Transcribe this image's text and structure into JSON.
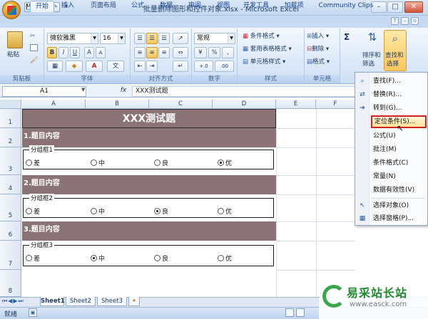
{
  "window": {
    "title": "批量删除图形和控件对象.xlsx - Microsoft Excel",
    "min": "–",
    "max": "□",
    "close": "✕"
  },
  "qat": [
    "💾",
    "↶",
    "↷",
    "▾"
  ],
  "tabs": [
    "开始",
    "插入",
    "页面布局",
    "公式",
    "数据",
    "审阅",
    "视图",
    "开发工具",
    "加载项",
    "Community Clips"
  ],
  "ribbon": {
    "clipboard": {
      "label": "剪贴板",
      "paste": "粘贴"
    },
    "font": {
      "label": "字体",
      "name": "微软雅黑",
      "size": "16",
      "bold": "B",
      "italic": "I",
      "underline": "U",
      "grow": "A",
      "shrink": "A",
      "fontcolor": "A",
      "wen": "文"
    },
    "align": {
      "label": "对齐方式"
    },
    "number": {
      "label": "数字",
      "format": "常规",
      "percent": "%",
      "comma": ",",
      "dec_inc": "+.0",
      "dec_dec": ".00"
    },
    "styles": {
      "label": "样式",
      "cond": "条件格式",
      "table": "套用表格格式",
      "cell": "单元格样式"
    },
    "cells": {
      "label": "单元格",
      "insert": "插入",
      "delete": "删除",
      "format": "格式"
    },
    "editing": {
      "sum": "Σ",
      "sort": "排序和",
      "sort2": "筛选",
      "find": "查找和",
      "find2": "选择"
    }
  },
  "formula_bar": {
    "namebox": "A1",
    "fx": "fx",
    "content": "XXX测试题"
  },
  "columns": [
    "A",
    "B",
    "C",
    "D",
    "E",
    "F"
  ],
  "rows": [
    "1",
    "2",
    "3",
    "4",
    "5",
    "6",
    "7",
    "8"
  ],
  "sheet": {
    "title": "XXX测试题",
    "sections": [
      {
        "heading": "1.题目内容",
        "group": "分组框1",
        "options": [
          "差",
          "中",
          "良",
          "优"
        ],
        "selected": 3
      },
      {
        "heading": "2.题目内容",
        "group": "分组框2",
        "options": [
          "差",
          "中",
          "良",
          "优"
        ],
        "selected": 2
      },
      {
        "heading": "3.题目内容",
        "group": "分组框3",
        "options": [
          "差",
          "中",
          "良",
          "优"
        ],
        "selected": 1
      }
    ]
  },
  "menu": {
    "items": [
      {
        "label": "查找(F)...",
        "icon": "⌕"
      },
      {
        "label": "替换(R)...",
        "icon": "⇄"
      },
      {
        "label": "转到(G)...",
        "icon": "➔"
      },
      {
        "label": "定位条件(S)...",
        "icon": ""
      },
      {
        "label": "公式(U)",
        "icon": ""
      },
      {
        "label": "批注(M)",
        "icon": ""
      },
      {
        "label": "条件格式(C)",
        "icon": ""
      },
      {
        "label": "常量(N)",
        "icon": ""
      },
      {
        "label": "数据有效性(V)",
        "icon": ""
      },
      {
        "label": "选择对象(O)",
        "icon": "↖"
      },
      {
        "label": "选择窗格(P)...",
        "icon": "▦"
      }
    ],
    "highlighted": "定位条件(S)..."
  },
  "sheet_tabs": [
    "Sheet1",
    "Sheet2",
    "Sheet3"
  ],
  "status": "就绪",
  "watermark": {
    "name": "易采站长站",
    "url": "www.easck.com"
  }
}
